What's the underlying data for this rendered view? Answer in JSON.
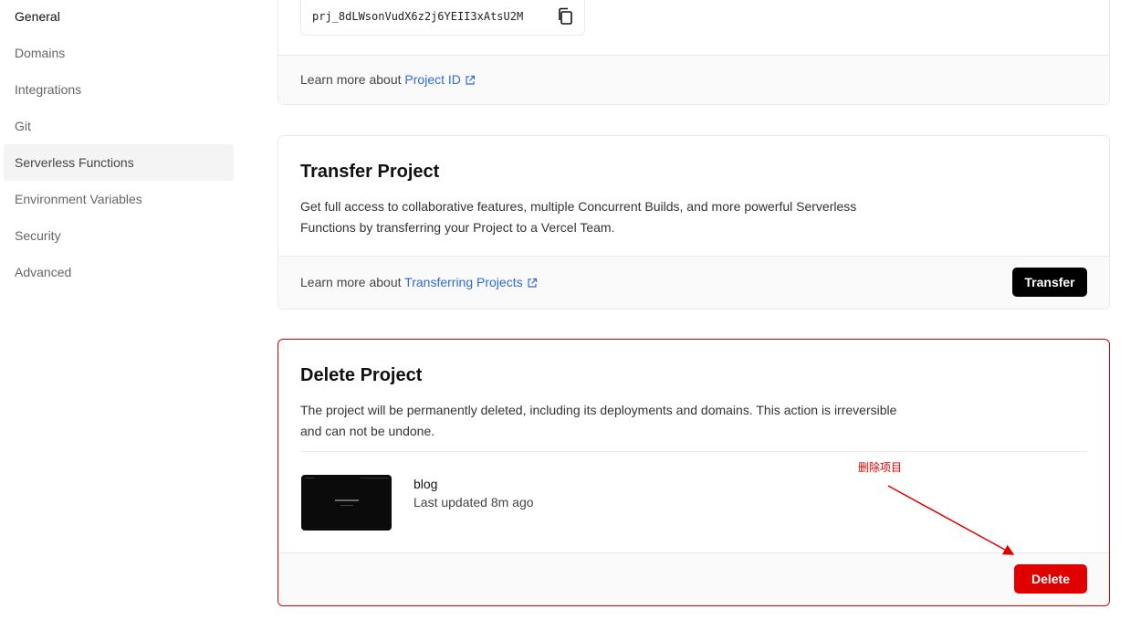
{
  "sidebar": {
    "items": [
      {
        "label": "General"
      },
      {
        "label": "Domains"
      },
      {
        "label": "Integrations"
      },
      {
        "label": "Git"
      },
      {
        "label": "Serverless Functions"
      },
      {
        "label": "Environment Variables"
      },
      {
        "label": "Security"
      },
      {
        "label": "Advanced"
      }
    ]
  },
  "project_id": {
    "value": "prj_8dLWsonVudX6z2j6YEII3xAtsU2M",
    "learn_prefix": "Learn more about",
    "learn_link": "Project ID"
  },
  "transfer": {
    "title": "Transfer Project",
    "description": "Get full access to collaborative features, multiple Concurrent Builds, and more powerful Serverless Functions by transferring your Project to a Vercel Team.",
    "learn_prefix": "Learn more about",
    "learn_link": "Transferring Projects",
    "button_label": "Transfer"
  },
  "delete": {
    "title": "Delete Project",
    "description": "The project will be permanently deleted, including its deployments and domains. This action is irreversible and can not be undone.",
    "project_name": "blog",
    "last_updated": "Last updated 8m ago",
    "button_label": "Delete"
  },
  "annotation": {
    "text": "删除项目",
    "color": "#e00000"
  },
  "colors": {
    "link": "#2f6bd6",
    "danger": "#e00000",
    "primary_button": "#000000"
  }
}
